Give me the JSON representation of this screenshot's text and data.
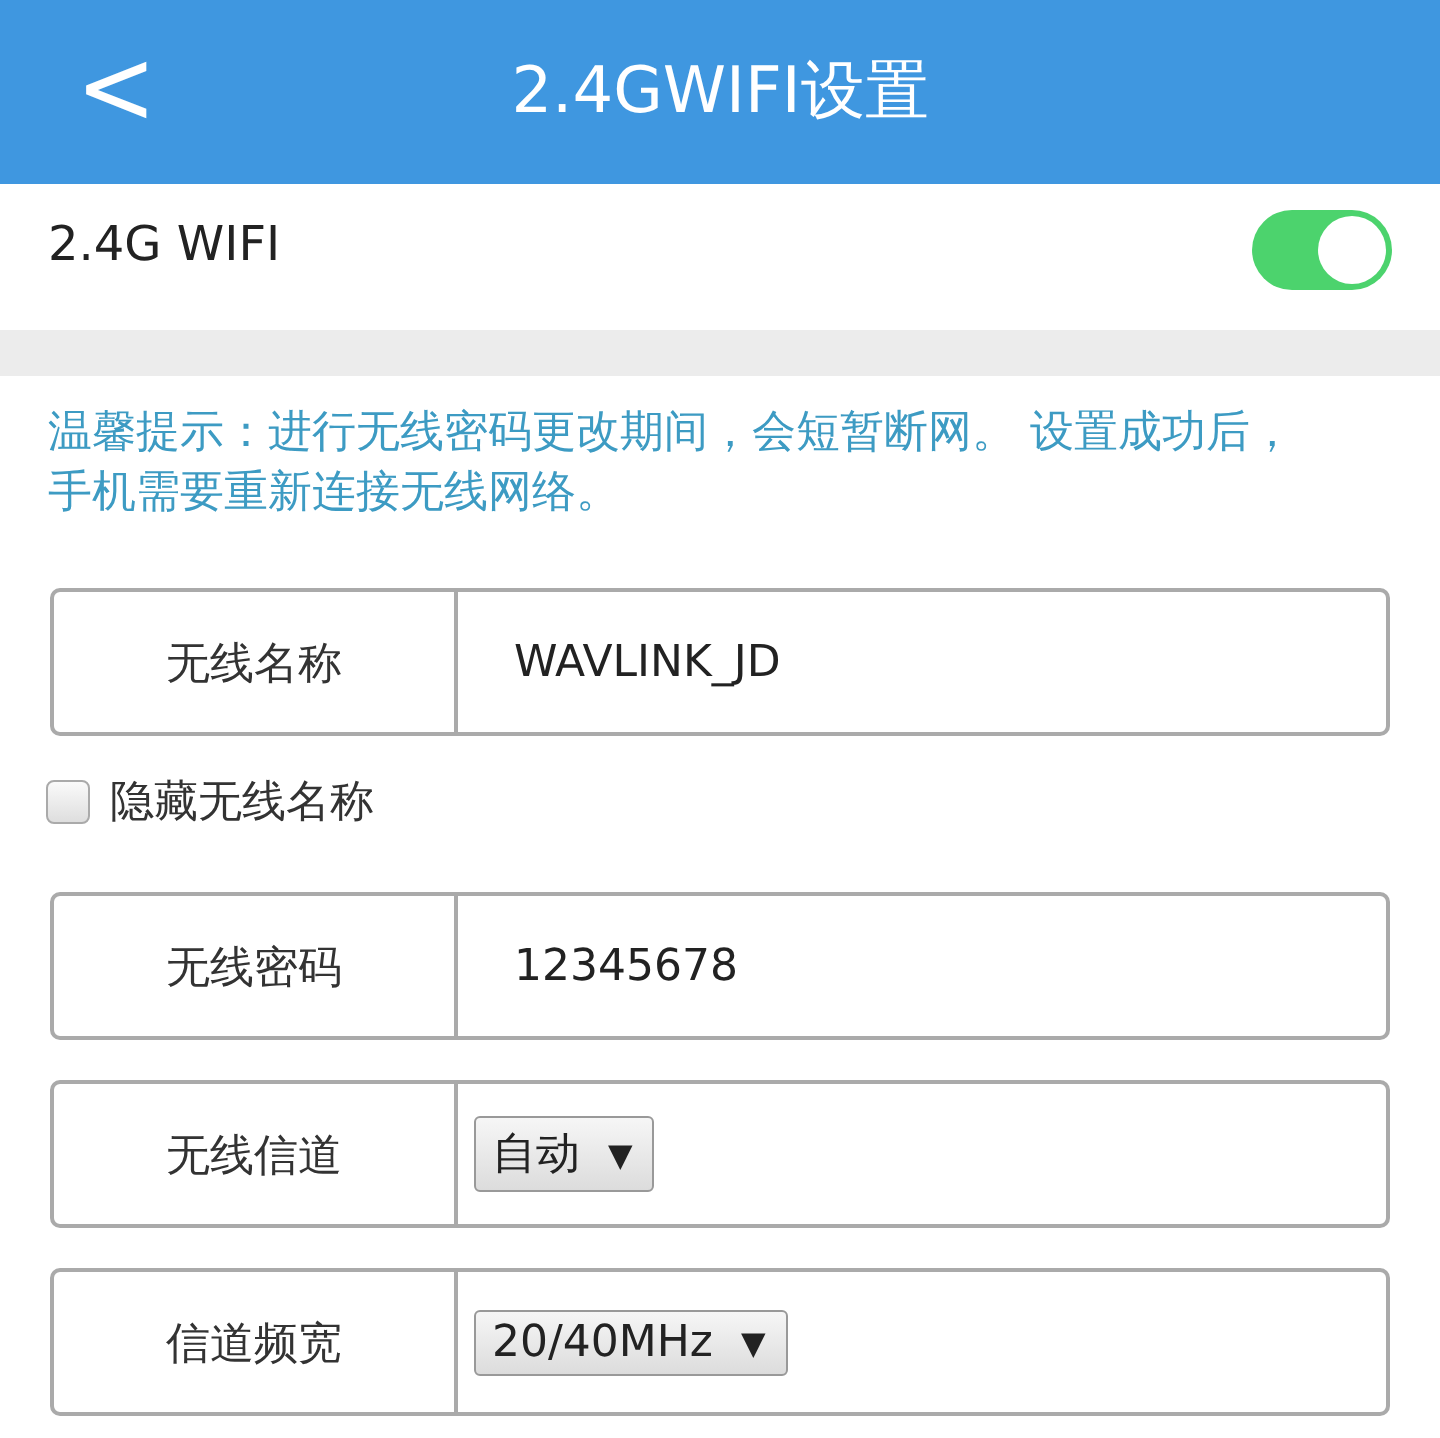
{
  "header": {
    "back_icon": "<",
    "title": "2.4GWIFI设置"
  },
  "wifi_switch": {
    "label": "2.4G WIFI",
    "on": true
  },
  "hint": "温馨提示：进行无线密码更改期间，会短暂断网。 设置成功后，手机需要重新连接无线网络。",
  "fields": [
    {
      "kind": "text",
      "label": "无线名称",
      "value": "WAVLINK_JD"
    },
    {
      "kind": "checkbox",
      "label": "隐藏无线名称",
      "checked": false
    },
    {
      "kind": "text",
      "label": "无线密码",
      "value": "12345678"
    },
    {
      "kind": "select",
      "label": "无线信道",
      "value": "自动",
      "arrow": "▼"
    },
    {
      "kind": "select",
      "label": "信道频宽",
      "value": "20/40MHz",
      "arrow": "▼"
    }
  ]
}
